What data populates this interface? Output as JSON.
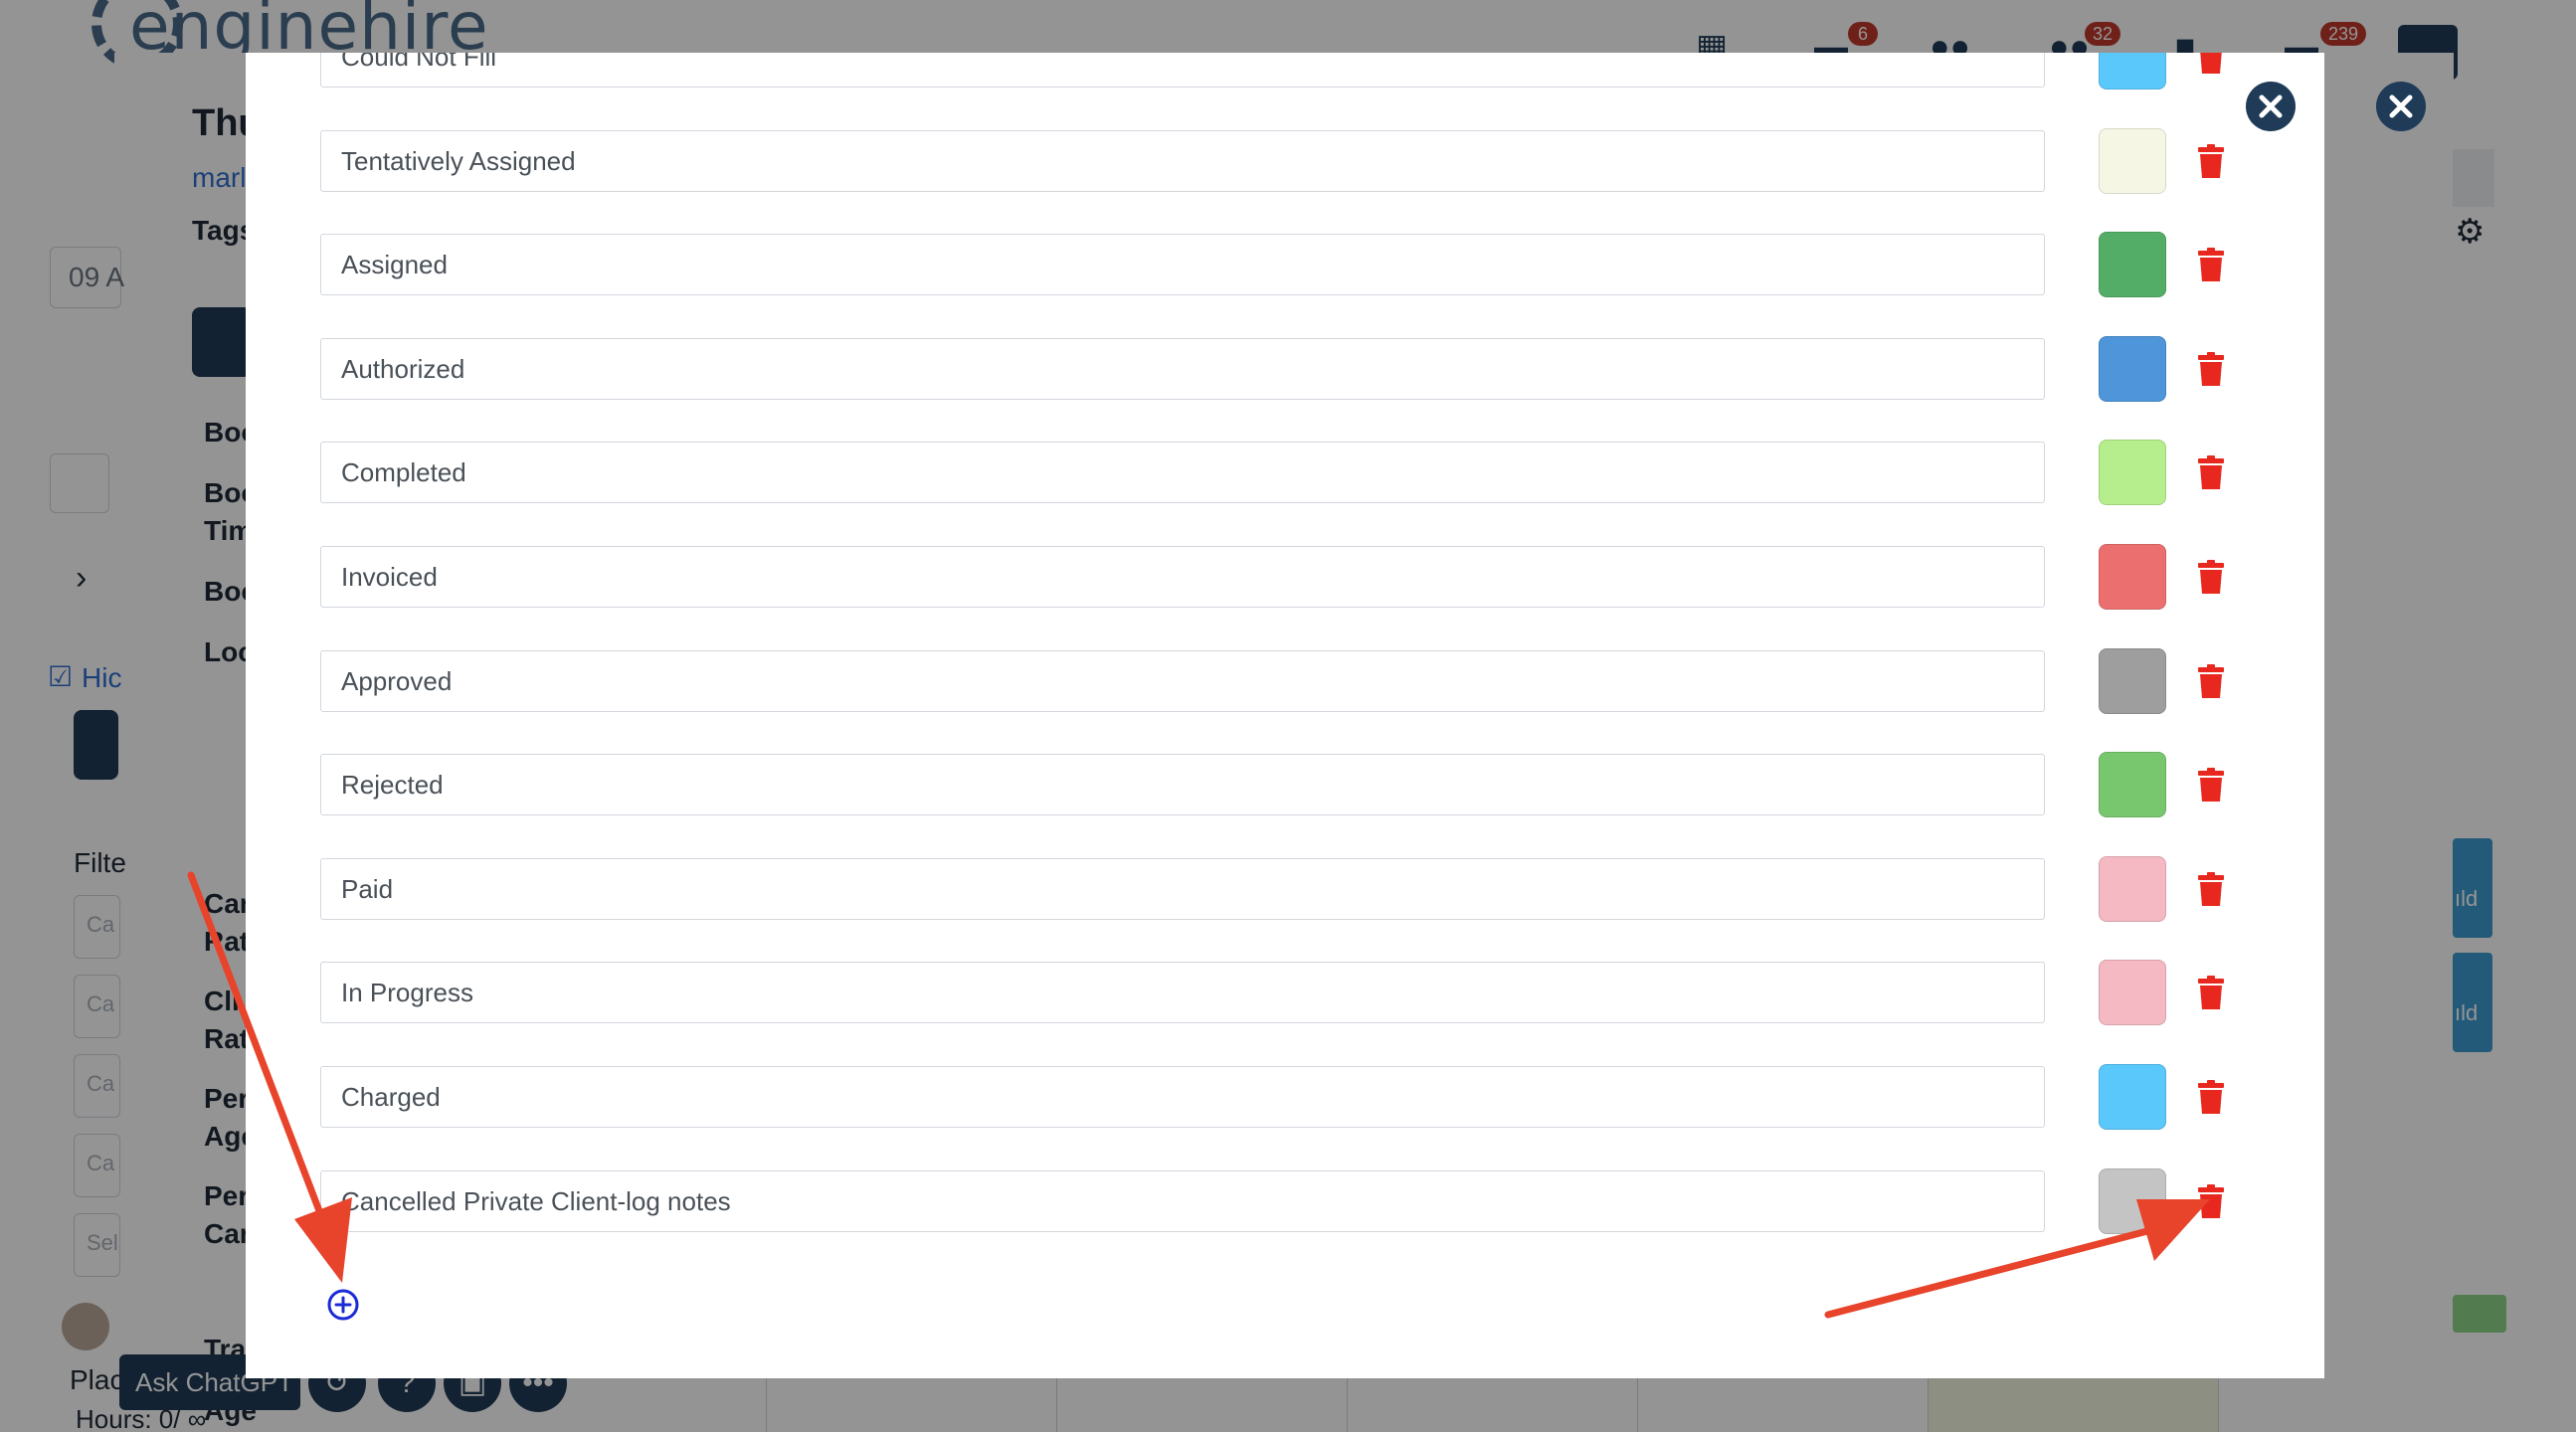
{
  "app": {
    "logo_text": "enginehire",
    "nav_badges": {
      "messages": "6",
      "contacts": "32",
      "chats": "239"
    },
    "page_title_fragment": "Thu",
    "link_fragment": "marli",
    "tags_label": "Tags",
    "date_fragment": "09 A",
    "left_labels": [
      "Boo",
      "Boo",
      "Tim",
      "Boo",
      "Loc",
      "Car",
      "Rat",
      "Cli",
      "Rat",
      "Per",
      "Age",
      "Per",
      "Car",
      "Trav",
      "Age"
    ],
    "hide_label": "Hic",
    "filter_label": "Filte",
    "filter_fields": [
      "Ca",
      "Ca",
      "Ca",
      "Ca",
      "Sel"
    ],
    "bottom_place": "Plac",
    "hours_text": "Hours: 0/ ∞",
    "chat_button": "Ask ChatGPT",
    "event_fragments": [
      "ıld",
      "ıld"
    ]
  },
  "modal": {
    "statuses": [
      {
        "label": "Could Not Fill",
        "color": "#5ac8fa"
      },
      {
        "label": "Tentatively Assigned",
        "color": "#f6f6e4"
      },
      {
        "label": "Assigned",
        "color": "#54ad66"
      },
      {
        "label": "Authorized",
        "color": "#4e95d9"
      },
      {
        "label": "Completed",
        "color": "#b6ee8e"
      },
      {
        "label": "Invoiced",
        "color": "#ec6f6f"
      },
      {
        "label": "Approved",
        "color": "#9e9e9e"
      },
      {
        "label": "Rejected",
        "color": "#78c76f"
      },
      {
        "label": "Paid",
        "color": "#f4b9c2"
      },
      {
        "label": "In Progress",
        "color": "#f4b9c2"
      },
      {
        "label": "Charged",
        "color": "#5ac8fa"
      },
      {
        "label": "Cancelled Private Client-log notes",
        "color": "#c4c4c4"
      }
    ],
    "add_icon": "plus-circle-icon",
    "delete_icon": "trash-icon",
    "close_icon": "close-icon",
    "accent_color": "#e8432b"
  }
}
